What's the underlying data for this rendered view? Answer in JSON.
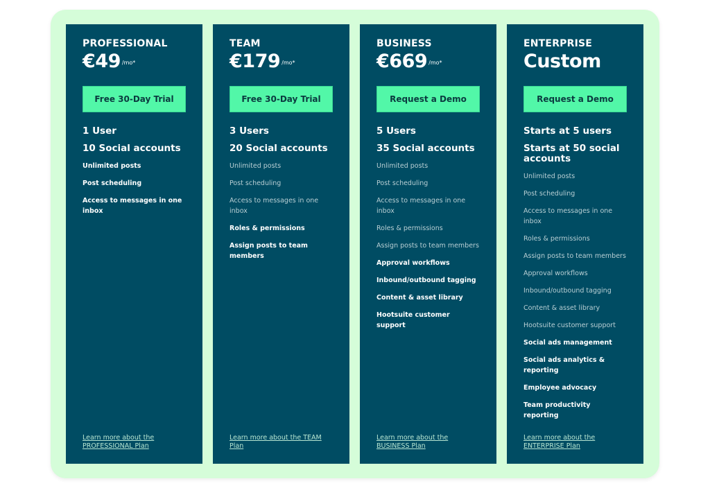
{
  "colors": {
    "card_bg": "#004c63",
    "frame_bg": "#d5fdd9",
    "button_bg": "#52f7a8",
    "button_text": "#0b3a3f"
  },
  "plans": [
    {
      "name": "PROFESSIONAL",
      "price": "€49",
      "per": "/mo*",
      "button": "Free 30-Day Trial",
      "headline1": "1 User",
      "headline2": "10 Social accounts",
      "features": [
        {
          "label": "Unlimited posts",
          "new": true
        },
        {
          "label": "Post scheduling",
          "new": true
        },
        {
          "label": "Access to messages in one inbox",
          "new": true
        }
      ],
      "learn_more": "Learn more about the PROFESSIONAL Plan"
    },
    {
      "name": "TEAM",
      "price": "€179",
      "per": "/mo*",
      "button": "Free 30-Day Trial",
      "headline1": "3 Users",
      "headline2": "20 Social accounts",
      "features": [
        {
          "label": "Unlimited posts",
          "new": false
        },
        {
          "label": "Post scheduling",
          "new": false
        },
        {
          "label": "Access to messages in one inbox",
          "new": false
        },
        {
          "label": "Roles & permissions",
          "new": true
        },
        {
          "label": "Assign posts to team members",
          "new": true
        }
      ],
      "learn_more": "Learn more about the TEAM Plan"
    },
    {
      "name": "BUSINESS",
      "price": "€669",
      "per": "/mo*",
      "button": "Request a Demo",
      "headline1": "5 Users",
      "headline2": "35 Social accounts",
      "features": [
        {
          "label": "Unlimited posts",
          "new": false
        },
        {
          "label": "Post scheduling",
          "new": false
        },
        {
          "label": "Access to messages in one inbox",
          "new": false
        },
        {
          "label": "Roles & permissions",
          "new": false
        },
        {
          "label": "Assign posts to team members",
          "new": false
        },
        {
          "label": "Approval workflows",
          "new": true
        },
        {
          "label": "Inbound/outbound tagging",
          "new": true
        },
        {
          "label": "Content & asset library",
          "new": true
        },
        {
          "label": "Hootsuite customer support",
          "new": true
        }
      ],
      "learn_more": "Learn more about the BUSINESS Plan"
    },
    {
      "name": "ENTERPRISE",
      "price": "Custom",
      "per": "",
      "button": "Request a Demo",
      "headline1": "Starts at 5 users",
      "headline2": "Starts at 50 social accounts",
      "features": [
        {
          "label": "Unlimited posts",
          "new": false
        },
        {
          "label": "Post scheduling",
          "new": false
        },
        {
          "label": "Access to messages in one inbox",
          "new": false
        },
        {
          "label": "Roles & permissions",
          "new": false
        },
        {
          "label": "Assign posts to team members",
          "new": false
        },
        {
          "label": "Approval workflows",
          "new": false
        },
        {
          "label": "Inbound/outbound tagging",
          "new": false
        },
        {
          "label": "Content & asset library",
          "new": false
        },
        {
          "label": "Hootsuite customer support",
          "new": false
        },
        {
          "label": "Social ads management",
          "new": true
        },
        {
          "label": "Social ads analytics & reporting",
          "new": true
        },
        {
          "label": "Employee advocacy",
          "new": true
        },
        {
          "label": "Team productivity reporting",
          "new": true
        }
      ],
      "learn_more": "Learn more about the ENTERPRISE Plan"
    }
  ]
}
